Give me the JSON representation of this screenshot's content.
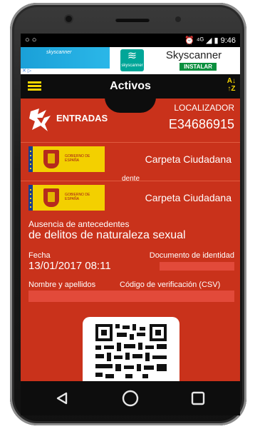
{
  "status_bar": {
    "left_icons": "○ ○",
    "right_text": "⏰ ⁴ᴳ ◢ ▮ 9:46"
  },
  "ad": {
    "banner_brand": "skyscanner",
    "logo_caption": "skyscanner",
    "title": "Skyscanner",
    "install_label": "INSTALAR",
    "adchoices": "✕ ▷"
  },
  "app_bar": {
    "title": "Activos",
    "sort_top": "A↓",
    "sort_bottom": "↑Z"
  },
  "ticket": {
    "label": "ENTRADAS",
    "locator_label": "LOCALIZADOR",
    "locator_value": "E34686915"
  },
  "cards": [
    {
      "name": "Carpeta Ciudadana",
      "logo_text": "GOBIERNO DE ESPAÑA"
    },
    {
      "name": "Carpeta Ciudadana",
      "logo_text": "GOBIERNO DE ESPAÑA"
    }
  ],
  "peek_text": "dente",
  "detail": {
    "subtitle_line1": "Ausencia de antecedentes",
    "subtitle_line2": "de delitos de naturaleza sexual",
    "fecha_label": "Fecha",
    "fecha_value": "13/01/2017 08:11",
    "documento_label": "Documento de identidad",
    "nombre_label": "Nombre y apellidos",
    "csv_label": "Código de verificación (CSV)"
  },
  "colors": {
    "accent_red": "#c9321b",
    "yellow": "#f7d600",
    "install_green": "#0a8f3e",
    "redaction": "#e24a3a"
  },
  "icons": [
    "menu-icon",
    "sort-az-icon",
    "ticket-icon",
    "back-icon",
    "home-icon",
    "recents-icon"
  ]
}
